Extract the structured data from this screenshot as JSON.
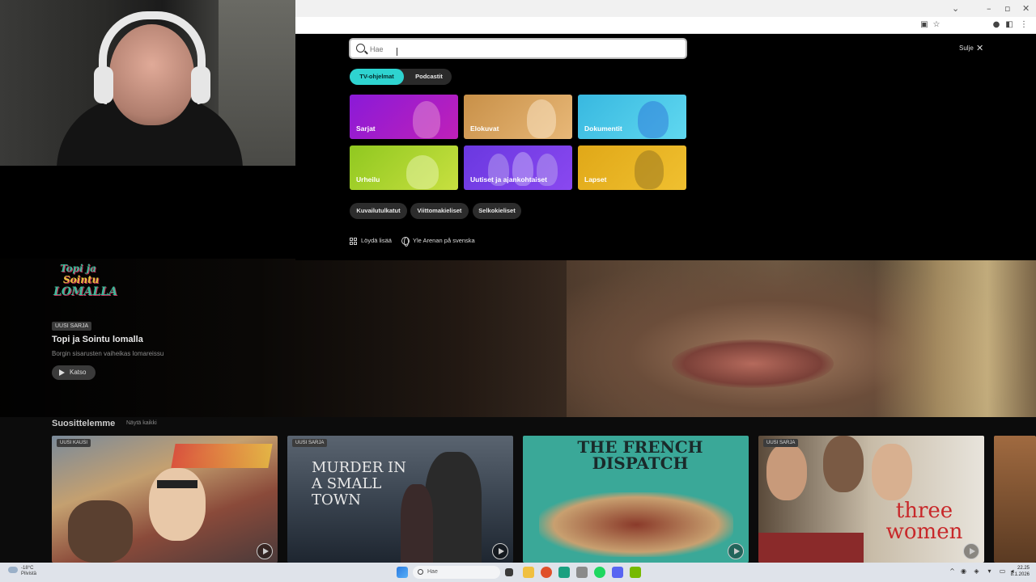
{
  "search": {
    "placeholder": "Hae"
  },
  "overlay": {
    "close_label": "Sulje",
    "tabs": [
      {
        "label": "TV-ohjelmat"
      },
      {
        "label": "Podcastit"
      }
    ],
    "categories": [
      {
        "label": "Sarjat"
      },
      {
        "label": "Elokuvat"
      },
      {
        "label": "Dokumentit"
      },
      {
        "label": "Urheilu"
      },
      {
        "label": "Uutiset ja ajankohtaiset"
      },
      {
        "label": "Lapset"
      }
    ],
    "chips": [
      {
        "label": "Kuvailutulkatut"
      },
      {
        "label": "Viittomakieliset"
      },
      {
        "label": "Selkokieliset"
      }
    ],
    "links": {
      "discover": "Löydä lisää",
      "swedish": "Yle Arenan på svenska"
    }
  },
  "hero": {
    "logo_lines": [
      "Topi ja",
      "Sointu",
      "LOMALLA"
    ],
    "badge": "UUSI SARJA",
    "title": "Topi ja Sointu lomalla",
    "description": "Borgin sisarusten vaiheikas lomareissu",
    "watch_label": "Katso"
  },
  "recommended": {
    "title": "Suosittelemme",
    "show_all": "Näytä kaikki",
    "cards": [
      {
        "badge": "UUSI KAUSI",
        "title_art": ""
      },
      {
        "badge": "UUSI SARJA",
        "title_art": "MURDER IN A SMALL TOWN"
      },
      {
        "badge": "",
        "title_art": "THE FRENCH DISPATCH"
      },
      {
        "badge": "UUSI SARJA",
        "title_art": "three women"
      }
    ]
  },
  "taskbar": {
    "weather_temp": "-18°C",
    "weather_desc": "Pilvistä",
    "search_label": "Hae",
    "time": "22.25",
    "date": "8.1.2026"
  }
}
